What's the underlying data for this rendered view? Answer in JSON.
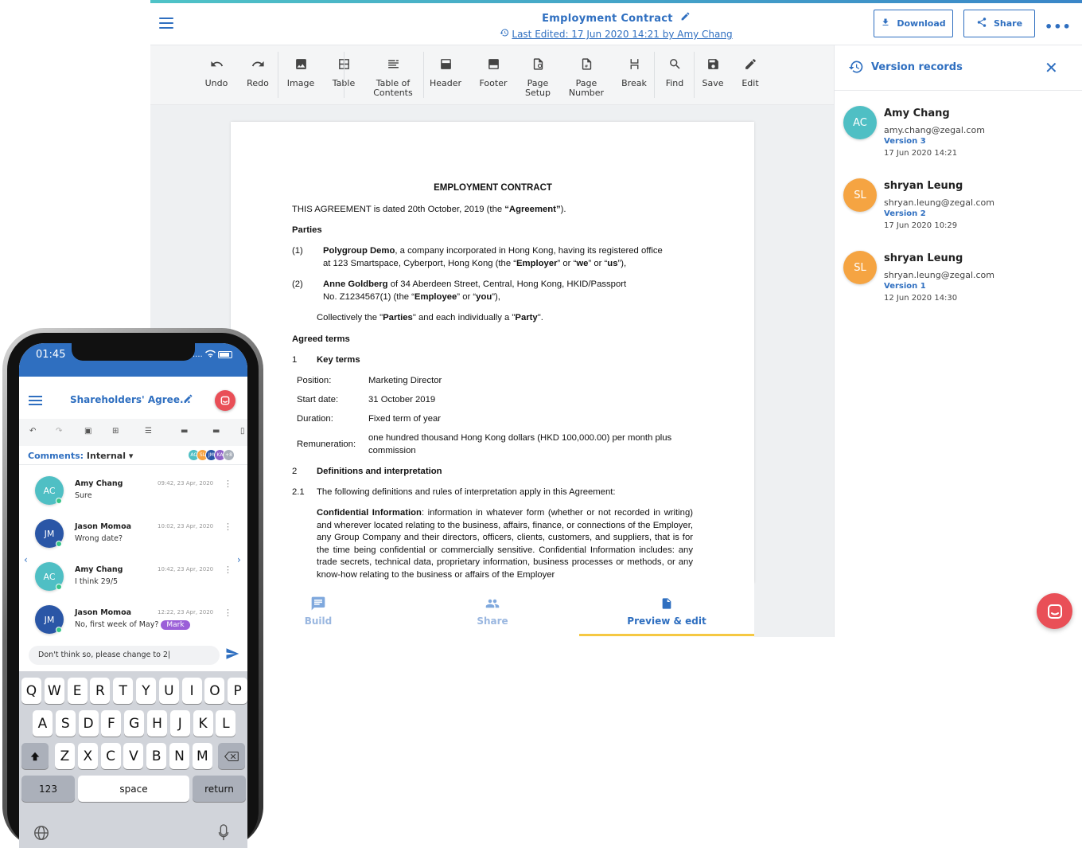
{
  "desktop": {
    "doc_title": "Employment Contract",
    "last_edited": "Last Edited: 17 Jun 2020 14:21 by Amy Chang",
    "download_label": "Download",
    "share_label": "Share",
    "toolbar": [
      {
        "label": "Undo",
        "icon": "undo-icon"
      },
      {
        "label": "Redo",
        "icon": "redo-icon"
      },
      {
        "label": "Image",
        "icon": "image-icon"
      },
      {
        "label": "Table",
        "icon": "table-icon"
      },
      {
        "label": "Table of\nContents",
        "icon": "toc-icon"
      },
      {
        "label": "Header",
        "icon": "header-icon"
      },
      {
        "label": "Footer",
        "icon": "footer-icon"
      },
      {
        "label": "Page\nSetup",
        "icon": "page-setup-icon"
      },
      {
        "label": "Page\nNumber",
        "icon": "page-number-icon"
      },
      {
        "label": "Break",
        "icon": "break-icon"
      },
      {
        "label": "Find",
        "icon": "search-icon"
      },
      {
        "label": "Save",
        "icon": "save-icon"
      },
      {
        "label": "Edit",
        "icon": "pencil-icon"
      }
    ],
    "document": {
      "heading": "EMPLOYMENT CONTRACT",
      "intro_pre": "THIS AGREEMENT is dated 20th October, 2019 (the ",
      "intro_bold": "“Agreement”",
      "intro_post": ").",
      "parties_heading": "Parties",
      "party1_num": "(1)",
      "party1_name": "Polygroup Demo",
      "party1_text1": ", a company incorporated in Hong Kong, having its registered office",
      "party1_text2a": "at 123 Smartspace, Cyberport, Hong Kong (the “",
      "party1_b1": "Employer",
      "party1_text2b": "” or “",
      "party1_b2": "we",
      "party1_text2c": "” or “",
      "party1_b3": "us",
      "party1_text2d": "”),",
      "party2_num": "(2)",
      "party2_name": "Anne Goldberg",
      "party2_text1": " of 34 Aberdeen Street, Central, Hong Kong, HKID/Passport",
      "party2_text2a": "No. Z1234567(1) (the “",
      "party2_b1": "Employee",
      "party2_text2b": "” or “",
      "party2_b2": "you",
      "party2_text2c": "”),",
      "collectively_a": "Collectively the \"",
      "collectively_b1": "Parties",
      "collectively_b": "\" and each individually a \"",
      "collectively_b2": "Party",
      "collectively_c": "\".",
      "agreed_heading": "Agreed terms",
      "s1_num": "1",
      "s1_title": "Key terms",
      "terms": [
        {
          "label": "Position:",
          "value": "Marketing Director"
        },
        {
          "label": "Start date:",
          "value": "31 October 2019"
        },
        {
          "label": "Duration:",
          "value": "Fixed term of  year"
        },
        {
          "label": "Remuneration:",
          "value": "one hundred thousand Hong Kong dollars (HKD 100,000.00) per month plus\ncommission"
        }
      ],
      "s2_num": "2",
      "s2_title": "Definitions and interpretation",
      "s21_num": "2.1",
      "s21_text": "The following definitions and rules of interpretation apply in this Agreement:",
      "ci_bold": "Confidential Information",
      "ci_text": ": information in whatever form (whether or not recorded in writing) and wherever located relating to the business, affairs, finance, or connections of the Employer, any Group Company and their directors, officers, clients, customers, and suppliers, that is for the time being confidential or commercially sensitive. Confidential Information includes: any trade secrets, technical data, proprietary information, business processes or methods, or any know-how relating to the business or affairs of the Employer"
    },
    "bottom_tabs": [
      {
        "label": "Build"
      },
      {
        "label": "Share"
      },
      {
        "label": "Preview & edit"
      }
    ],
    "sidebar": {
      "title": "Version records",
      "versions": [
        {
          "initials": "AC",
          "name": "Amy Chang",
          "email": "amy.chang@zegal.com",
          "version": "Version 3",
          "date": "17 Jun 2020 14:21",
          "color": "#4fbfc4"
        },
        {
          "initials": "SL",
          "name": "shryan Leung",
          "email": "shryan.leung@zegal.com",
          "version": "Version 2",
          "date": "17 Jun 2020 10:29",
          "color": "#f5a442"
        },
        {
          "initials": "SL",
          "name": "shryan Leung",
          "email": "shryan.leung@zegal.com",
          "version": "Version 1",
          "date": "12 Jun 2020 14:30",
          "color": "#f5a442"
        }
      ]
    },
    "colors": {
      "accent": "#2f6fc0",
      "fab": "#e94f57",
      "tab_indicator": "#f5c842"
    }
  },
  "mobile": {
    "time": "01:45",
    "signal": "....",
    "title": "Shareholders' Agree...",
    "comments_label": "Comments:",
    "comments_value": "Internal",
    "participants": [
      {
        "initials": "AC",
        "color": "#4fbfc4"
      },
      {
        "initials": "SL",
        "color": "#f5a442"
      },
      {
        "initials": "JM",
        "color": "#2a56a6"
      },
      {
        "initials": "KA",
        "color": "#8f62c9"
      },
      {
        "initials": "+8",
        "color": "#a9b0bb"
      }
    ],
    "comments": [
      {
        "initials": "AC",
        "name": "Amy Chang",
        "text": "Sure",
        "time": "09:42, 23 Apr, 2020",
        "color": "#4fbfc4"
      },
      {
        "initials": "JM",
        "name": "Jason Momoa",
        "text": "Wrong date?",
        "time": "10:02, 23 Apr, 2020",
        "color": "#2a56a6"
      },
      {
        "initials": "AC",
        "name": "Amy Chang",
        "text": "I think 29/5",
        "time": "10:42, 23 Apr, 2020",
        "color": "#4fbfc4"
      },
      {
        "initials": "JM",
        "name": "Jason Momoa",
        "text": "No, first week of May?",
        "time": "12:22, 23 Apr, 2020",
        "color": "#2a56a6",
        "tag": "Mark"
      }
    ],
    "input_value": "Don't think so, please change to 2|",
    "keyboard": {
      "row1": [
        "Q",
        "W",
        "E",
        "R",
        "T",
        "Y",
        "U",
        "I",
        "O",
        "P"
      ],
      "row2": [
        "A",
        "S",
        "D",
        "F",
        "G",
        "H",
        "J",
        "K",
        "L"
      ],
      "row3": [
        "Z",
        "X",
        "C",
        "V",
        "B",
        "N",
        "M"
      ],
      "numbers": "123",
      "space": "space",
      "return": "return"
    }
  }
}
